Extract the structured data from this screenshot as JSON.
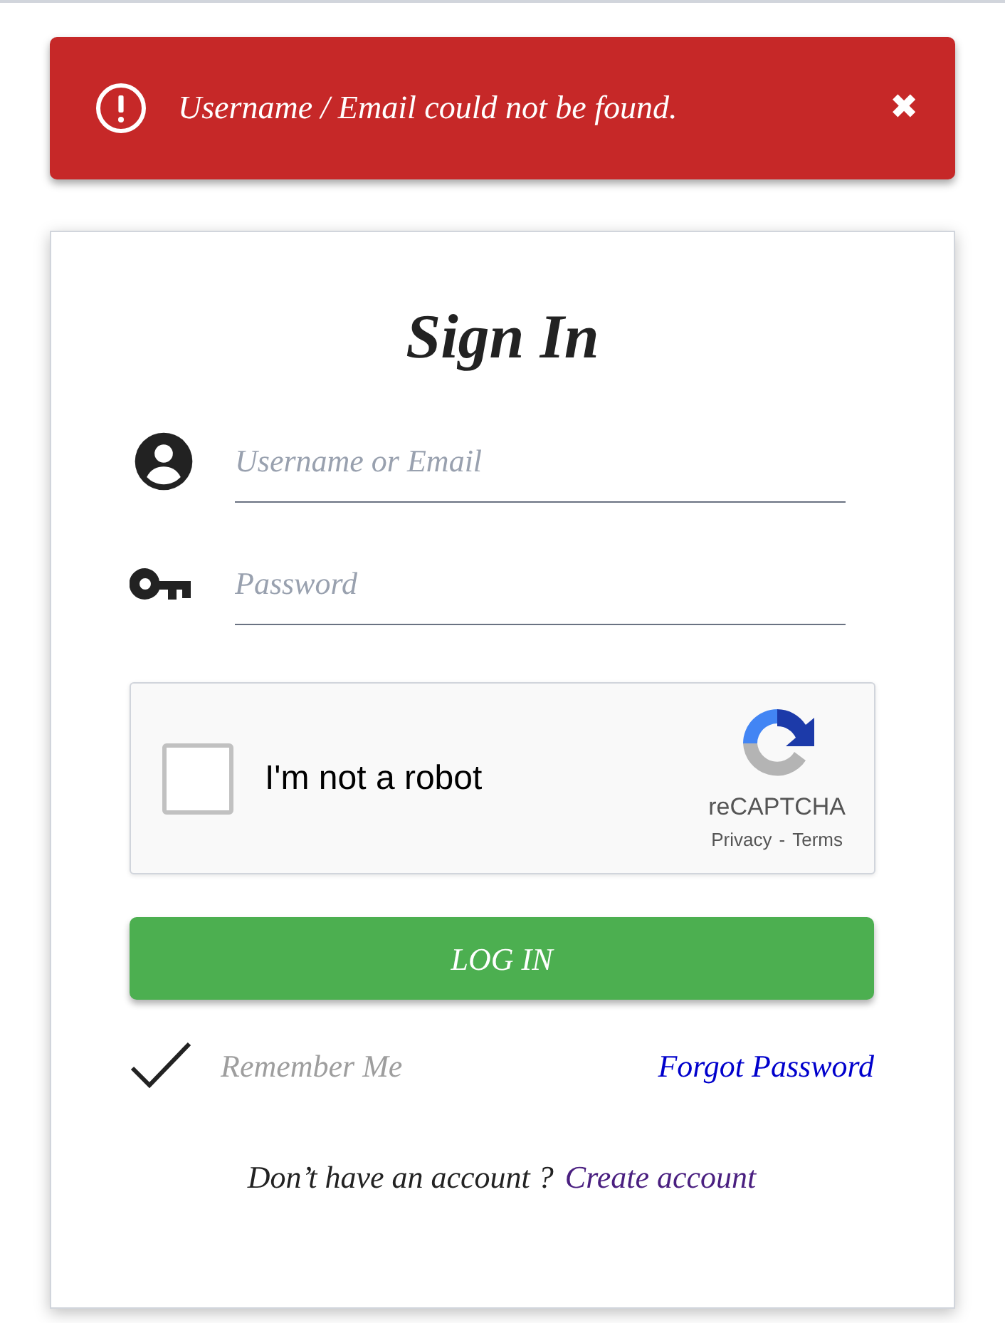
{
  "alert": {
    "message": "Username / Email could not be found.",
    "close": "✖"
  },
  "form": {
    "title": "Sign In",
    "fields": [
      {
        "kind": "user",
        "placeholder": "Username or Email"
      },
      {
        "kind": "password",
        "placeholder": "Password"
      }
    ],
    "captcha": {
      "label": "I'm not a robot",
      "checked": false,
      "brand": "reCAPTCHA",
      "privacy": "Privacy",
      "separator": "-",
      "terms": "Terms"
    },
    "submit": "LOG IN",
    "remember": {
      "label": "Remember Me",
      "checked": true
    },
    "forgot": "Forgot Password",
    "footer": {
      "text": "Don’t have an account ?",
      "link": "Create account"
    }
  }
}
